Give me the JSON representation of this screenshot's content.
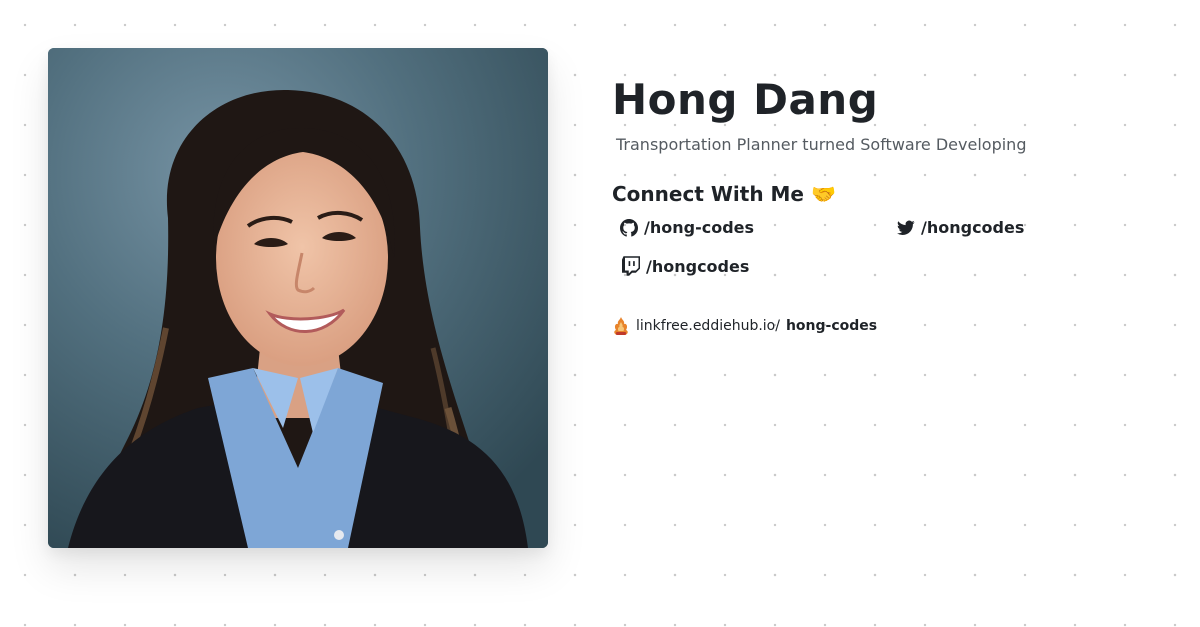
{
  "profile": {
    "name": "Hong Dang",
    "tagline": "Transportation Planner turned Software Developing",
    "photo_alt": "Hong Dang"
  },
  "connect": {
    "heading": "Connect With Me 🤝",
    "links": {
      "github": "/hong-codes",
      "twitter": "/hongcodes",
      "twitch": "/hongcodes"
    }
  },
  "linkfree": {
    "host": "linkfree.eddiehub.io/",
    "user": "hong-codes"
  },
  "icons": {
    "github": "github-icon",
    "twitter": "twitter-icon",
    "twitch": "twitch-icon",
    "linkfree": "linkfree-logo-icon"
  }
}
